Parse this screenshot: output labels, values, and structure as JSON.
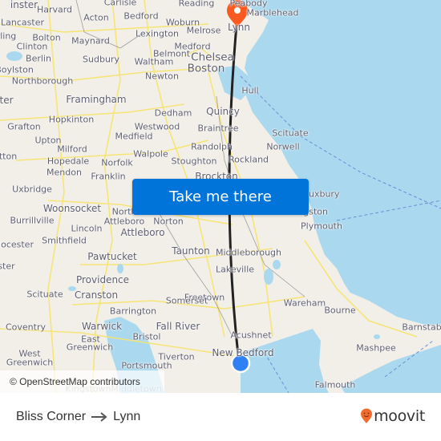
{
  "map": {
    "colors": {
      "land": "#f2efe9",
      "water": "#aad9ef",
      "road": "#f7e36b",
      "route_line": "#222222",
      "origin_dot": "#2f80f5",
      "destination_pin": "#fa5a1f"
    },
    "places": [
      {
        "name": "Leominster",
        "label": "inster",
        "size": "m"
      },
      {
        "name": "Carlisle",
        "label": "Carlisle",
        "size": "s"
      },
      {
        "name": "Reading",
        "label": "Reading",
        "size": "s"
      },
      {
        "name": "Peabody",
        "label": "Peabody",
        "size": "s"
      },
      {
        "name": "Marblehead",
        "label": "Marblehead",
        "size": "s"
      },
      {
        "name": "Harvard",
        "label": "Harvard",
        "size": "s"
      },
      {
        "name": "Acton",
        "label": "Acton",
        "size": "s"
      },
      {
        "name": "Bedford",
        "label": "Bedford",
        "size": "s"
      },
      {
        "name": "Woburn",
        "label": "Woburn",
        "size": "s"
      },
      {
        "name": "Melrose",
        "label": "Melrose",
        "size": "s"
      },
      {
        "name": "Lynn",
        "label": "Lynn",
        "size": "m"
      },
      {
        "name": "Lancaster",
        "label": "Lancaster",
        "size": "s"
      },
      {
        "name": "Bolton",
        "label": "Bolton",
        "size": "s"
      },
      {
        "name": "Lexington",
        "label": "Lexington",
        "size": "s"
      },
      {
        "name": "Sterling",
        "label": "rling",
        "size": "s"
      },
      {
        "name": "Clinton",
        "label": "Clinton",
        "size": "s"
      },
      {
        "name": "Maynard",
        "label": "Maynard",
        "size": "s"
      },
      {
        "name": "Medford",
        "label": "Medford",
        "size": "s"
      },
      {
        "name": "Berlin",
        "label": "Berlin",
        "size": "s"
      },
      {
        "name": "Belmont",
        "label": "Belmont",
        "size": "s"
      },
      {
        "name": "Chelsea",
        "label": "Chelsea",
        "size": "l"
      },
      {
        "name": "Sudbury",
        "label": "Sudbury",
        "size": "s"
      },
      {
        "name": "Waltham",
        "label": "Waltham",
        "size": "s"
      },
      {
        "name": "Boylston",
        "label": "Boylston",
        "size": "s"
      },
      {
        "name": "Boston",
        "label": "Boston",
        "size": "l"
      },
      {
        "name": "Northborough",
        "label": "Northborough",
        "size": "s"
      },
      {
        "name": "Newton",
        "label": "Newton",
        "size": "s"
      },
      {
        "name": "Hull",
        "label": "Hull",
        "size": "s"
      },
      {
        "name": "Worcester",
        "label": "ter",
        "size": "m"
      },
      {
        "name": "Framingham",
        "label": "Framingham",
        "size": "m"
      },
      {
        "name": "Dedham",
        "label": "Dedham",
        "size": "s"
      },
      {
        "name": "Quincy",
        "label": "Quincy",
        "size": "m"
      },
      {
        "name": "Hopkinton",
        "label": "Hopkinton",
        "size": "s"
      },
      {
        "name": "Grafton",
        "label": "Grafton",
        "size": "s"
      },
      {
        "name": "Westwood",
        "label": "Westwood",
        "size": "s"
      },
      {
        "name": "Braintree",
        "label": "Braintree",
        "size": "s"
      },
      {
        "name": "Scituate",
        "label": "Scituate",
        "size": "s"
      },
      {
        "name": "Medfield",
        "label": "Medfield",
        "size": "s"
      },
      {
        "name": "Upton",
        "label": "Upton",
        "size": "s"
      },
      {
        "name": "Randolph",
        "label": "Randolph",
        "size": "s"
      },
      {
        "name": "Norwell",
        "label": "Norwell",
        "size": "s"
      },
      {
        "name": "Milford",
        "label": "Milford",
        "size": "s"
      },
      {
        "name": "Walpole",
        "label": "Walpole",
        "size": "s"
      },
      {
        "name": "Sutton",
        "label": "tton",
        "size": "s"
      },
      {
        "name": "Hopedale",
        "label": "Hopedale",
        "size": "s"
      },
      {
        "name": "Norfolk",
        "label": "Norfolk",
        "size": "s"
      },
      {
        "name": "Stoughton",
        "label": "Stoughton",
        "size": "s"
      },
      {
        "name": "Rockland",
        "label": "Rockland",
        "size": "s"
      },
      {
        "name": "Mendon",
        "label": "Mendon",
        "size": "s"
      },
      {
        "name": "Franklin",
        "label": "Franklin",
        "size": "s"
      },
      {
        "name": "Brockton",
        "label": "Brockton",
        "size": "m"
      },
      {
        "name": "Uxbridge",
        "label": "Uxbridge",
        "size": "s"
      },
      {
        "name": "Duxbury",
        "label": "Duxbury",
        "size": "s"
      },
      {
        "name": "Woonsocket",
        "label": "Woonsocket",
        "size": "m"
      },
      {
        "name": "North Attleboro",
        "label": "North",
        "size": "s"
      },
      {
        "name": "North Attleboro 2",
        "label": "Attleboro",
        "size": "s"
      },
      {
        "name": "Kingston",
        "label": "Kingston",
        "size": "s"
      },
      {
        "name": "Burrillville",
        "label": "Burrillville",
        "size": "s"
      },
      {
        "name": "Norton",
        "label": "Norton",
        "size": "s"
      },
      {
        "name": "Lincoln",
        "label": "Lincoln",
        "size": "s"
      },
      {
        "name": "Plymouth",
        "label": "Plymouth",
        "size": "s"
      },
      {
        "name": "Attleboro",
        "label": "Attleboro",
        "size": "m"
      },
      {
        "name": "Glocester",
        "label": "locester",
        "size": "s"
      },
      {
        "name": "Smithfield",
        "label": "Smithfield",
        "size": "s"
      },
      {
        "name": "Taunton",
        "label": "Taunton",
        "size": "m"
      },
      {
        "name": "Middleborough",
        "label": "Middleborough",
        "size": "s"
      },
      {
        "name": "Pawtucket",
        "label": "Pawtucket",
        "size": "m"
      },
      {
        "name": "Foster",
        "label": "ster",
        "size": "s"
      },
      {
        "name": "Lakeville",
        "label": "Lakeville",
        "size": "s"
      },
      {
        "name": "Providence",
        "label": "Providence",
        "size": "m"
      },
      {
        "name": "Freetown",
        "label": "Freetown",
        "size": "s"
      },
      {
        "name": "Scituate RI",
        "label": "Scituate",
        "size": "s"
      },
      {
        "name": "Cranston",
        "label": "Cranston",
        "size": "m"
      },
      {
        "name": "Somerset",
        "label": "Somerset",
        "size": "s"
      },
      {
        "name": "Wareham",
        "label": "Wareham",
        "size": "s"
      },
      {
        "name": "Bourne",
        "label": "Bourne",
        "size": "s"
      },
      {
        "name": "Barrington",
        "label": "Barrington",
        "size": "s"
      },
      {
        "name": "Coventry",
        "label": "Coventry",
        "size": "s"
      },
      {
        "name": "Warwick",
        "label": "Warwick",
        "size": "m"
      },
      {
        "name": "Fall River",
        "label": "Fall River",
        "size": "m"
      },
      {
        "name": "Barnstable",
        "label": "Barnstab",
        "size": "s"
      },
      {
        "name": "Acushnet",
        "label": "Acushnet",
        "size": "s"
      },
      {
        "name": "East",
        "label": "East",
        "size": "s"
      },
      {
        "name": "Bristol",
        "label": "Bristol",
        "size": "s"
      },
      {
        "name": "Greenwich",
        "label": "Greenwich",
        "size": "s"
      },
      {
        "name": "Mashpee",
        "label": "Mashpee",
        "size": "s"
      },
      {
        "name": "New Bedford",
        "label": "New Bedford",
        "size": "m"
      },
      {
        "name": "West",
        "label": "West",
        "size": "s"
      },
      {
        "name": "Tiverton",
        "label": "Tiverton",
        "size": "s"
      },
      {
        "name": "West Greenwich",
        "label": "Greenwich",
        "size": "s"
      },
      {
        "name": "Portsmouth",
        "label": "Portsmouth",
        "size": "s"
      },
      {
        "name": "Falmouth",
        "label": "Falmouth",
        "size": "s"
      },
      {
        "name": "North Kingstown",
        "label": "Kingstown",
        "size": "s"
      },
      {
        "name": "Middletown",
        "label": "Middletown",
        "size": "s"
      }
    ],
    "origin": {
      "name": "Bliss Corner",
      "marker": "origin-dot"
    },
    "destination": {
      "name": "Lynn",
      "marker": "destination-pin"
    },
    "attribution": "© OpenStreetMap contributors"
  },
  "cta": {
    "label": "Take me there"
  },
  "footer": {
    "origin": "Bliss Corner",
    "arrow_icon": "arrow-right-icon",
    "destination": "Lynn",
    "brand": "moovit",
    "brand_color": "#f26b2e"
  }
}
